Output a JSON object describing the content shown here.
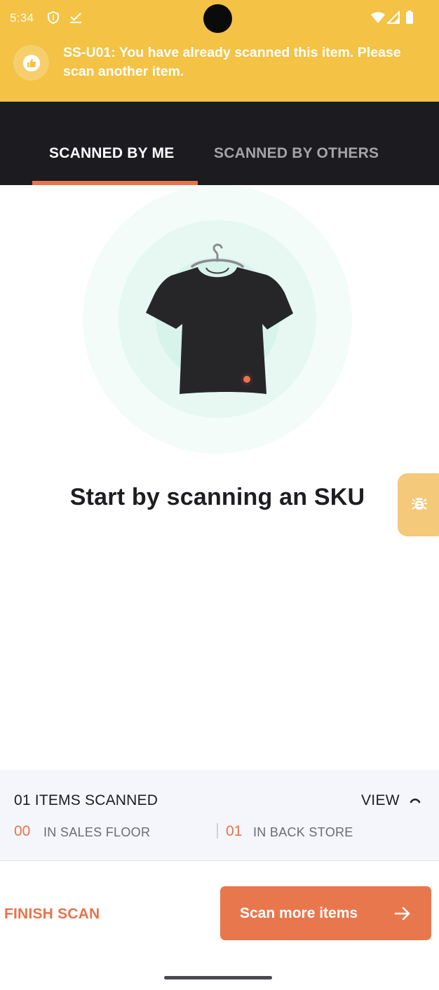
{
  "status_bar": {
    "time": "5:34",
    "left_icons": [
      "shield-icon",
      "download-done-icon"
    ],
    "right_icons": [
      "wifi-icon",
      "signal-icon",
      "battery-icon"
    ]
  },
  "toast": {
    "icon": "thumbs-up-icon",
    "message": "SS-U01: You have already scanned this item. Please scan another item.",
    "background": "#f4c244"
  },
  "tabs": [
    {
      "label": "SCANNED BY ME",
      "active": true
    },
    {
      "label": "SCANNED BY OTHERS",
      "active": false
    }
  ],
  "main": {
    "illustration": "t-shirt-on-hanger-illustration",
    "empty_title": "Start by scanning an SKU"
  },
  "debug_button": {
    "icon": "bug-icon"
  },
  "summary": {
    "title": "01 ITEMS SCANNED",
    "view_label": "VIEW",
    "view_icon": "chevron-up-icon",
    "sales_floor": {
      "count": "00",
      "label": "IN SALES FLOOR"
    },
    "back_store": {
      "count": "01",
      "label": "IN BACK STORE"
    }
  },
  "actions": {
    "finish_label": "FINISH SCAN",
    "scan_more_label": "Scan more items",
    "scan_more_icon": "arrow-right-icon"
  },
  "colors": {
    "accent": "#e8734c",
    "tab_bar": "#1c1c20",
    "summary_bg": "#f4f6fb",
    "debug_fab": "#f4c97a"
  }
}
